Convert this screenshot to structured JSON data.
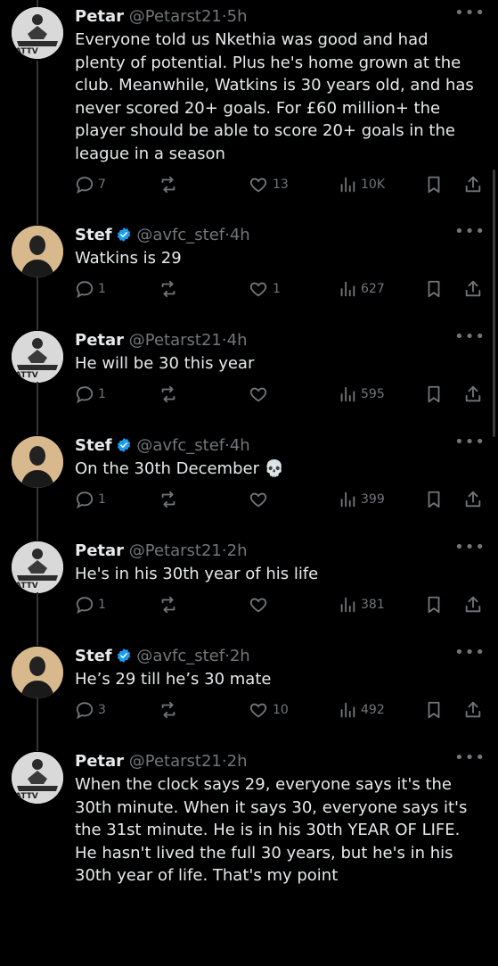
{
  "colors": {
    "background": "#000000",
    "text": "#e7e9ea",
    "muted": "#71767b",
    "verified": "#1d9bf0"
  },
  "tweets": [
    {
      "name": "Petar",
      "handle": "@Petarst21",
      "time": "5h",
      "verified": false,
      "text": "Everyone told us Nkethia was good and had plenty of potential. Plus he's home grown at the club. Meanwhile, Watkins is 30 years old, and has never scored 20+ goals. For £60 million+ the player should be able to score 20+ goals in the league in a season",
      "replies": "7",
      "reposts": "",
      "likes": "13",
      "views": "10K"
    },
    {
      "name": "Stef",
      "handle": "@avfc_stef",
      "time": "4h",
      "verified": true,
      "text": "Watkins is 29",
      "replies": "1",
      "reposts": "",
      "likes": "1",
      "views": "627"
    },
    {
      "name": "Petar",
      "handle": "@Petarst21",
      "time": "4h",
      "verified": false,
      "text": "He will be 30 this year",
      "replies": "1",
      "reposts": "",
      "likes": "",
      "views": "595"
    },
    {
      "name": "Stef",
      "handle": "@avfc_stef",
      "time": "4h",
      "verified": true,
      "text": "On the 30th December 💀",
      "replies": "1",
      "reposts": "",
      "likes": "",
      "views": "399"
    },
    {
      "name": "Petar",
      "handle": "@Petarst21",
      "time": "2h",
      "verified": false,
      "text": "He's in his 30th year of his life",
      "replies": "1",
      "reposts": "",
      "likes": "",
      "views": "381"
    },
    {
      "name": "Stef",
      "handle": "@avfc_stef",
      "time": "2h",
      "verified": true,
      "text": "He’s 29 till he’s 30 mate",
      "replies": "3",
      "reposts": "",
      "likes": "10",
      "views": "492"
    },
    {
      "name": "Petar",
      "handle": "@Petarst21",
      "time": "2h",
      "verified": false,
      "text": "When the clock says 29, everyone says it's the 30th minute. When it says 30, everyone says it's the 31st minute. He is in his 30th YEAR OF LIFE. He hasn't lived the full 30 years, but he's in his 30th year of life. That's my point",
      "replies": "",
      "reposts": "",
      "likes": "",
      "views": ""
    }
  ]
}
